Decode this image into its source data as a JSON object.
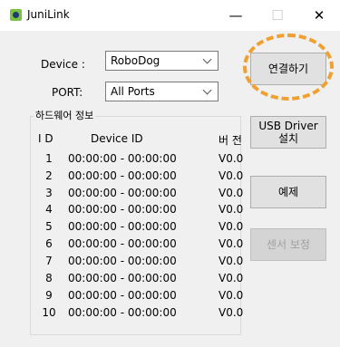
{
  "window": {
    "title": "JuniLink",
    "minimize_glyph": "—",
    "maximize_glyph": "☐",
    "close_glyph": "✕"
  },
  "device": {
    "label": "Device :",
    "value": "RoboDog"
  },
  "port": {
    "label": "PORT:",
    "value": "All Ports"
  },
  "hardware_info": {
    "title": "하드웨어 정보",
    "headers": {
      "id": "I D",
      "device_id": "Device ID",
      "version": "버 전"
    },
    "rows": [
      {
        "num": "1",
        "device_id": "00:00:00 - 00:00:00",
        "version": "V0.0"
      },
      {
        "num": "2",
        "device_id": "00:00:00 - 00:00:00",
        "version": "V0.0"
      },
      {
        "num": "3",
        "device_id": "00:00:00 - 00:00:00",
        "version": "V0.0"
      },
      {
        "num": "4",
        "device_id": "00:00:00 - 00:00:00",
        "version": "V0.0"
      },
      {
        "num": "5",
        "device_id": "00:00:00 - 00:00:00",
        "version": "V0.0"
      },
      {
        "num": "6",
        "device_id": "00:00:00 - 00:00:00",
        "version": "V0.0"
      },
      {
        "num": "7",
        "device_id": "00:00:00 - 00:00:00",
        "version": "V0.0"
      },
      {
        "num": "8",
        "device_id": "00:00:00 - 00:00:00",
        "version": "V0.0"
      },
      {
        "num": "9",
        "device_id": "00:00:00 - 00:00:00",
        "version": "V0.0"
      },
      {
        "num": "10",
        "device_id": "00:00:00 - 00:00:00",
        "version": "V0.0"
      }
    ]
  },
  "buttons": {
    "connect": "연결하기",
    "usb_driver_line1": "USB Driver",
    "usb_driver_line2": "설치",
    "example": "예제",
    "sensor_calibration": "센서 보정"
  },
  "colors": {
    "highlight_ring": "#f0a030",
    "app_icon": "#7cc242"
  }
}
